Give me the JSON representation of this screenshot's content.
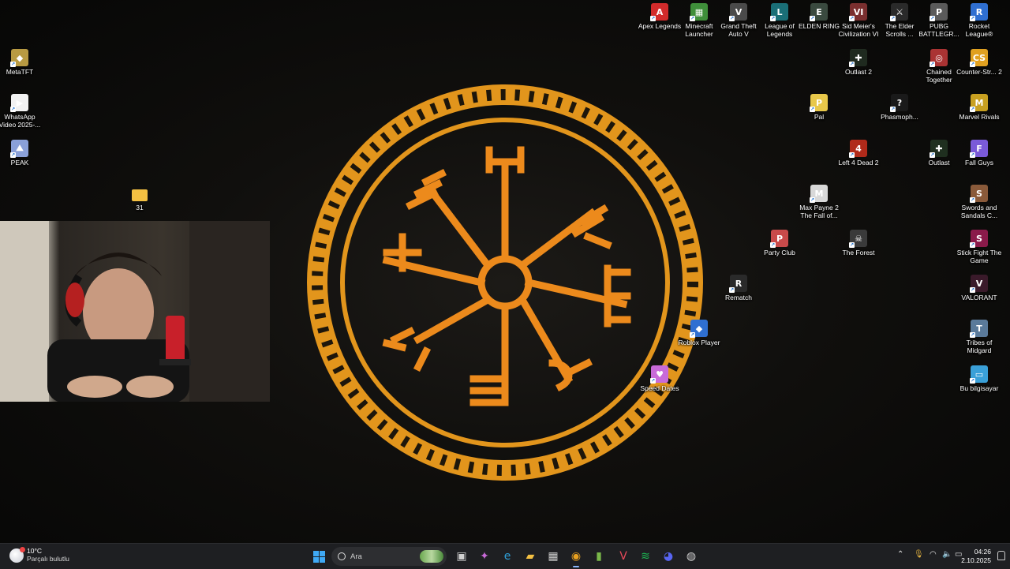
{
  "desktop": {
    "icons": [
      {
        "label": "Apex Legends",
        "color": "#d22b2b",
        "glyph": "A"
      },
      {
        "label": "Minecraft Launcher",
        "color": "#3f8f3a",
        "glyph": "▦"
      },
      {
        "label": "Grand Theft Auto V",
        "color": "#4a4a4a",
        "glyph": "V"
      },
      {
        "label": "League of Legends",
        "color": "#1a6f77",
        "glyph": "L"
      },
      {
        "label": "ELDEN RING",
        "color": "#3a4a3f",
        "glyph": "E"
      },
      {
        "label": "Sid Meier's Civilization VI",
        "color": "#7a2f2f",
        "glyph": "VI"
      },
      {
        "label": "The Elder Scrolls ...",
        "color": "#2a2a2a",
        "glyph": "⚔"
      },
      {
        "label": "PUBG BATTLEGR...",
        "color": "#5a5a5a",
        "glyph": "P"
      },
      {
        "label": "Rocket League®",
        "color": "#2f6fd1",
        "glyph": "R"
      },
      {
        "label": "MetaTFT",
        "color": "#b89a42",
        "glyph": "◆"
      },
      {
        "label": "WhatsApp Video 2025-...",
        "color": "#f2f2f2",
        "glyph": "▶"
      },
      {
        "label": "PEAK",
        "color": "#8aa0d8",
        "glyph": "⛰"
      },
      {
        "label": "31",
        "color": "#f4c042",
        "glyph": ""
      },
      {
        "label": "Outlast 2",
        "color": "#1f2a1f",
        "glyph": "✚"
      },
      {
        "label": "Chained Together",
        "color": "#a33",
        "glyph": "◎"
      },
      {
        "label": "Counter-Str... 2",
        "color": "#e0a020",
        "glyph": "CS"
      },
      {
        "label": "Pal",
        "color": "#e8c84a",
        "glyph": "P"
      },
      {
        "label": "Phasmoph...",
        "color": "#1a1a1a",
        "glyph": "?"
      },
      {
        "label": "Marvel Rivals",
        "color": "#c8a020",
        "glyph": "M"
      },
      {
        "label": "Left 4 Dead 2",
        "color": "#b02a1a",
        "glyph": "4"
      },
      {
        "label": "Outlast",
        "color": "#1f2f1f",
        "glyph": "✚"
      },
      {
        "label": "Fall Guys",
        "color": "#7a5ad8",
        "glyph": "F"
      },
      {
        "label": "Max Payne 2 The Fall of...",
        "color": "#d8d8d8",
        "glyph": "M"
      },
      {
        "label": "Swords and Sandals C...",
        "color": "#8a5a3a",
        "glyph": "S"
      },
      {
        "label": "Party Club",
        "color": "#c84a4a",
        "glyph": "P"
      },
      {
        "label": "The Forest",
        "color": "#3a3a3a",
        "glyph": "☠"
      },
      {
        "label": "Stick Fight The Game",
        "color": "#8a1a4a",
        "glyph": "S"
      },
      {
        "label": "Rematch",
        "color": "#2a2a2a",
        "glyph": "R"
      },
      {
        "label": "VALORANT",
        "color": "#3a1a2a",
        "glyph": "V"
      },
      {
        "label": "Roblox Player",
        "color": "#2f6fd1",
        "glyph": "◆"
      },
      {
        "label": "Tribes of Midgard",
        "color": "#5a7a9a",
        "glyph": "T"
      },
      {
        "label": "Speed Dates",
        "color": "#c86ad8",
        "glyph": "♥"
      },
      {
        "label": "Bu bilgisayar",
        "color": "#3aa0d8",
        "glyph": "▭"
      }
    ]
  },
  "taskbar": {
    "weather_temp": "10°C",
    "weather_desc": "Parçalı bulutlu",
    "search_placeholder": "Ara",
    "apps": [
      {
        "name": "start-button",
        "glyph": "⊞",
        "color": "#3fa9f5"
      },
      {
        "name": "task-view-button",
        "glyph": "▣",
        "color": "#d0d0d0"
      },
      {
        "name": "copilot-button",
        "glyph": "✦",
        "color": "#c86ad8"
      },
      {
        "name": "edge-button",
        "glyph": "e",
        "color": "#2fa0d8"
      },
      {
        "name": "file-explorer-button",
        "glyph": "▰",
        "color": "#f4c042"
      },
      {
        "name": "store-button",
        "glyph": "▦",
        "color": "#d0d0d0"
      },
      {
        "name": "chrome-button",
        "glyph": "◉",
        "color": "#e8a020"
      },
      {
        "name": "minecraft-button",
        "glyph": "▮",
        "color": "#7ab84a"
      },
      {
        "name": "valorant-button",
        "glyph": "V",
        "color": "#e84a5a"
      },
      {
        "name": "spotify-button",
        "glyph": "≋",
        "color": "#1db954"
      },
      {
        "name": "discord-button",
        "glyph": "◕",
        "color": "#5865f2"
      },
      {
        "name": "obs-button",
        "glyph": "◍",
        "color": "#d0d0d0"
      }
    ],
    "time": "04:26",
    "date": "2.10.2025"
  }
}
